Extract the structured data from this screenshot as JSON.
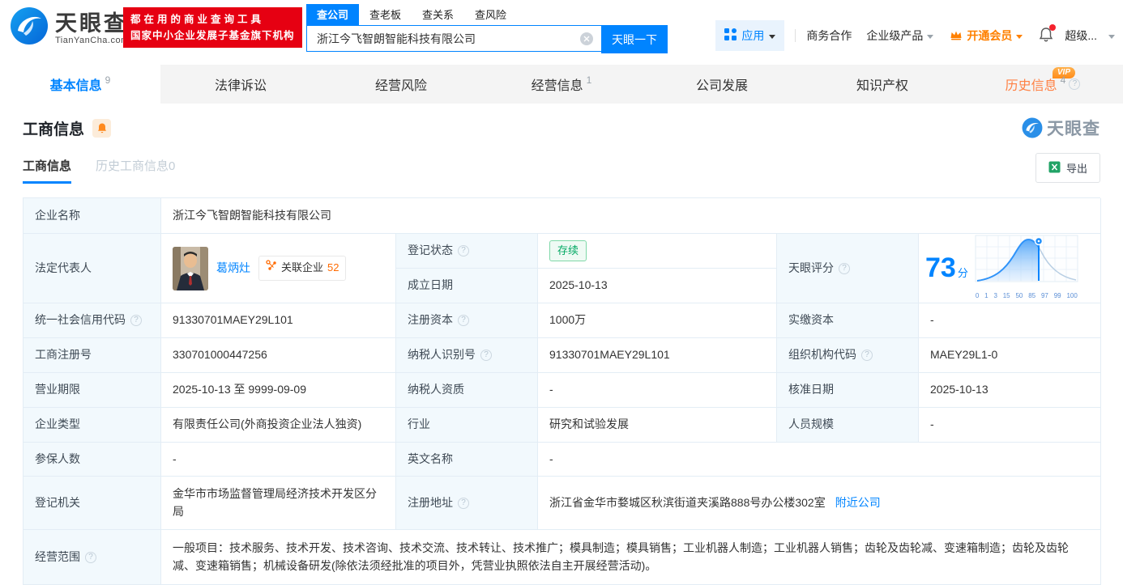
{
  "brand": {
    "name": "天眼查",
    "domain": "TianYanCha.com",
    "slogan_line1": "都在用的商业查询工具",
    "slogan_line2": "国家中小企业发展子基金旗下机构"
  },
  "search": {
    "tabs": [
      "查公司",
      "查老板",
      "查关系",
      "查风险"
    ],
    "value": "浙江今飞智朗智能科技有限公司",
    "button": "天眼一下"
  },
  "topnav": {
    "apps": "应用",
    "biz_coop": "商务合作",
    "enterprise_products": "企业级产品",
    "open_vip": "开通会员",
    "super_vip": "超级..."
  },
  "tabs": {
    "basic": {
      "label": "基本信息",
      "count": "9"
    },
    "legal": {
      "label": "法律诉讼"
    },
    "risk": {
      "label": "经营风险"
    },
    "operation": {
      "label": "经营信息",
      "count": "1"
    },
    "development": {
      "label": "公司发展"
    },
    "ip": {
      "label": "知识产权"
    },
    "history": {
      "label": "历史信息",
      "count": "4",
      "vip": "VIP"
    }
  },
  "section": {
    "title": "工商信息",
    "watermark": "天眼查",
    "subtab_current": "工商信息",
    "subtab_history": "历史工商信息0",
    "export_label": "导出"
  },
  "fields": {
    "company_name": {
      "label": "企业名称",
      "value": "浙江今飞智朗智能科技有限公司"
    },
    "legal_rep": {
      "label": "法定代表人",
      "name": "葛炳灶",
      "related_label": "关联企业",
      "related_count": "52"
    },
    "reg_status": {
      "label": "登记状态",
      "value": "存续"
    },
    "establish_date": {
      "label": "成立日期",
      "value": "2025-10-13"
    },
    "score": {
      "label": "天眼评分"
    },
    "credit_code": {
      "label": "统一社会信用代码",
      "value": "91330701MAEY29L101"
    },
    "reg_capital": {
      "label": "注册资本",
      "value": "1000万"
    },
    "paid_capital": {
      "label": "实缴资本",
      "value": "-"
    },
    "reg_number": {
      "label": "工商注册号",
      "value": "330701000447256"
    },
    "taxpayer_id": {
      "label": "纳税人识别号",
      "value": "91330701MAEY29L101"
    },
    "org_code": {
      "label": "组织机构代码",
      "value": "MAEY29L1-0"
    },
    "business_term": {
      "label": "营业期限",
      "value": "2025-10-13 至 9999-09-09"
    },
    "taxpayer_quality": {
      "label": "纳税人资质",
      "value": "-"
    },
    "approval_date": {
      "label": "核准日期",
      "value": "2025-10-13"
    },
    "company_type": {
      "label": "企业类型",
      "value": "有限责任公司(外商投资企业法人独资)"
    },
    "industry": {
      "label": "行业",
      "value": "研究和试验发展"
    },
    "staff_size": {
      "label": "人员规模",
      "value": "-"
    },
    "insured_count": {
      "label": "参保人数",
      "value": "-"
    },
    "english_name": {
      "label": "英文名称",
      "value": "-"
    },
    "reg_authority": {
      "label": "登记机关",
      "value": "金华市市场监督管理局经济技术开发区分局"
    },
    "reg_address": {
      "label": "注册地址",
      "value": "浙江省金华市婺城区秋滨街道夹溪路888号办公楼302室",
      "nearby_link": "附近公司"
    },
    "business_scope": {
      "label": "经营范围",
      "value": "一般项目：技术服务、技术开发、技术咨询、技术交流、技术转让、技术推广；模具制造；模具销售；工业机器人制造；工业机器人销售；齿轮及齿轮减、变速箱制造；齿轮及齿轮减、变速箱销售；机械设备研发(除依法须经批准的项目外，凭营业执照依法自主开展经营活动)。"
    }
  },
  "chart_data": {
    "type": "area",
    "title": "天眼评分",
    "score": "73",
    "score_unit": "分",
    "marker_value": 73,
    "axis_labels": [
      "0",
      "1",
      "3",
      "15",
      "50",
      "85",
      "97",
      "99",
      "100"
    ],
    "accent_color": "#0084ff"
  }
}
